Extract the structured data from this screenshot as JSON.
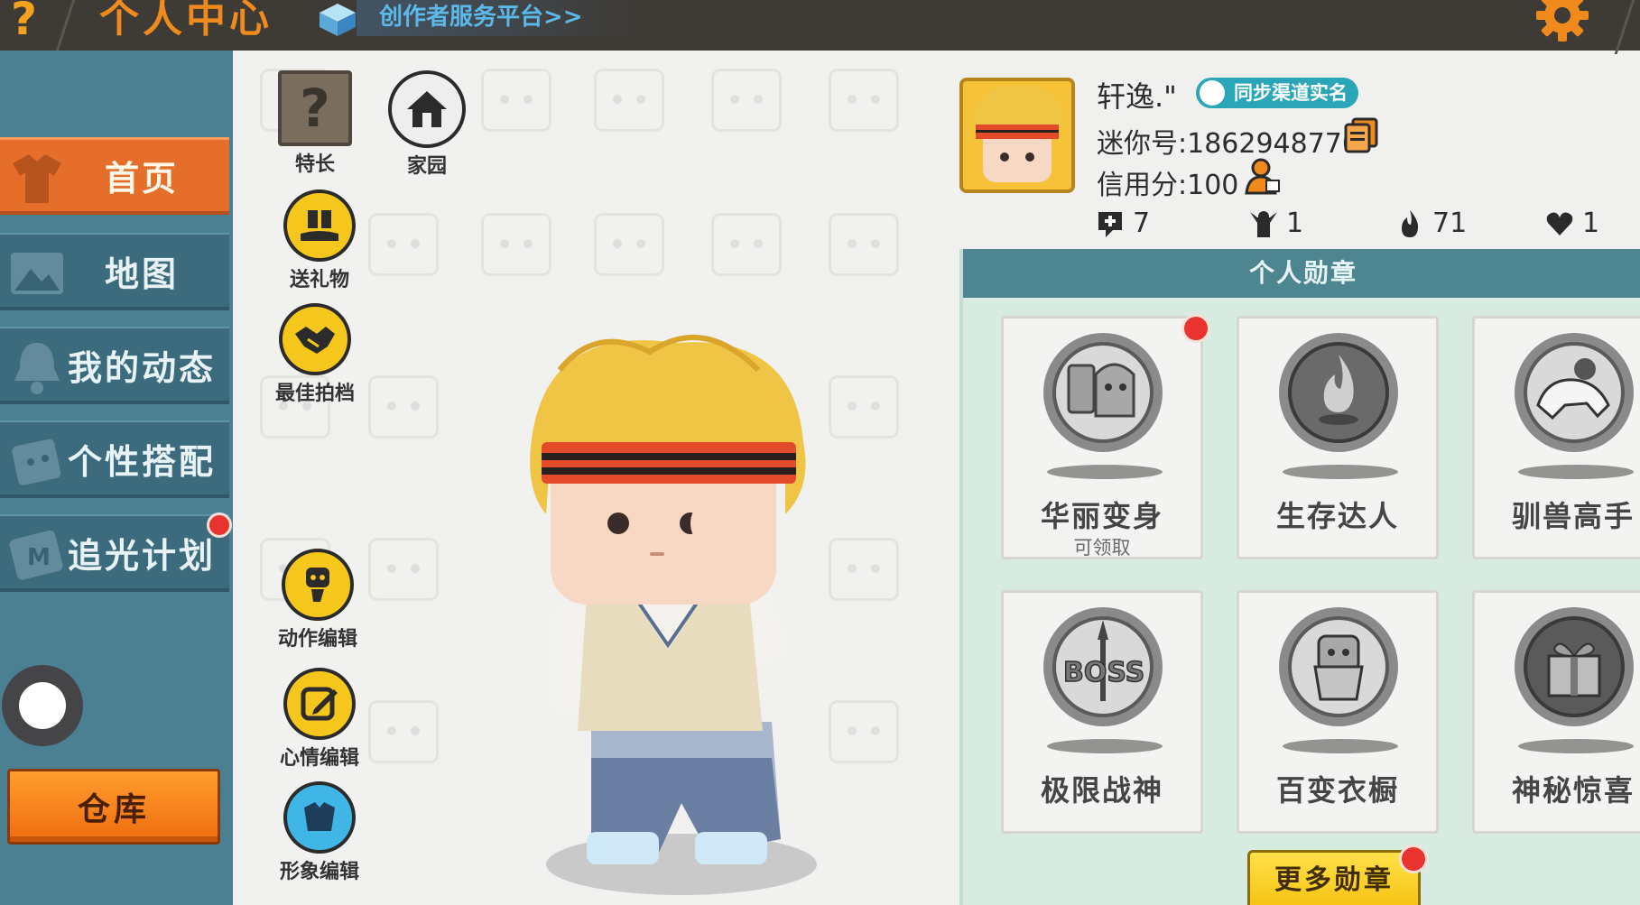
{
  "topbar": {
    "help_glyph": "?",
    "title": "个人中心",
    "creator_link": "创作者服务平台>>"
  },
  "sidebar": {
    "items": [
      {
        "label": "首页",
        "icon": "shirt-icon",
        "active": true
      },
      {
        "label": "地图",
        "icon": "picture-icon",
        "active": false
      },
      {
        "label": "我的动态",
        "icon": "bell-icon",
        "active": false
      },
      {
        "label": "个性搭配",
        "icon": "character-icon",
        "active": false
      },
      {
        "label": "追光计划",
        "icon": "m-logo-icon",
        "active": false,
        "has_dot": true
      }
    ],
    "warehouse_label": "仓库"
  },
  "functions": {
    "skill": "特长",
    "skill_glyph": "?",
    "home": "家园",
    "gift": "送礼物",
    "best_shot": "最佳拍档",
    "action_edit": "动作编辑",
    "mood_edit": "心情编辑",
    "image_edit": "形象编辑"
  },
  "profile": {
    "nickname": "轩逸.\"",
    "sync_badge": "同步渠道实名",
    "uid": "迷你号:1862948770",
    "credit": "信用分:100",
    "stats": [
      {
        "icon": "add-friend-icon",
        "value": "7"
      },
      {
        "icon": "fans-icon",
        "value": "1"
      },
      {
        "icon": "fire-icon",
        "value": "71"
      },
      {
        "icon": "heart-icon",
        "value": "1"
      }
    ]
  },
  "medals": {
    "header": "个人勋章",
    "items": [
      {
        "name": "华丽变身",
        "sub": "可领取",
        "has_dot": true
      },
      {
        "name": "生存达人",
        "sub": ""
      },
      {
        "name": "驯兽高手",
        "sub": ""
      },
      {
        "name": "极限战神",
        "sub": ""
      },
      {
        "name": "百变衣橱",
        "sub": ""
      },
      {
        "name": "神秘惊喜",
        "sub": ""
      }
    ],
    "more_label": "更多勋章"
  },
  "colors": {
    "accent_orange": "#e56f2a",
    "sidebar_teal": "#4b7f92",
    "header_teal": "#4d8590",
    "yellow": "#f5c61c",
    "badge_cyan": "#2aa6b8"
  }
}
